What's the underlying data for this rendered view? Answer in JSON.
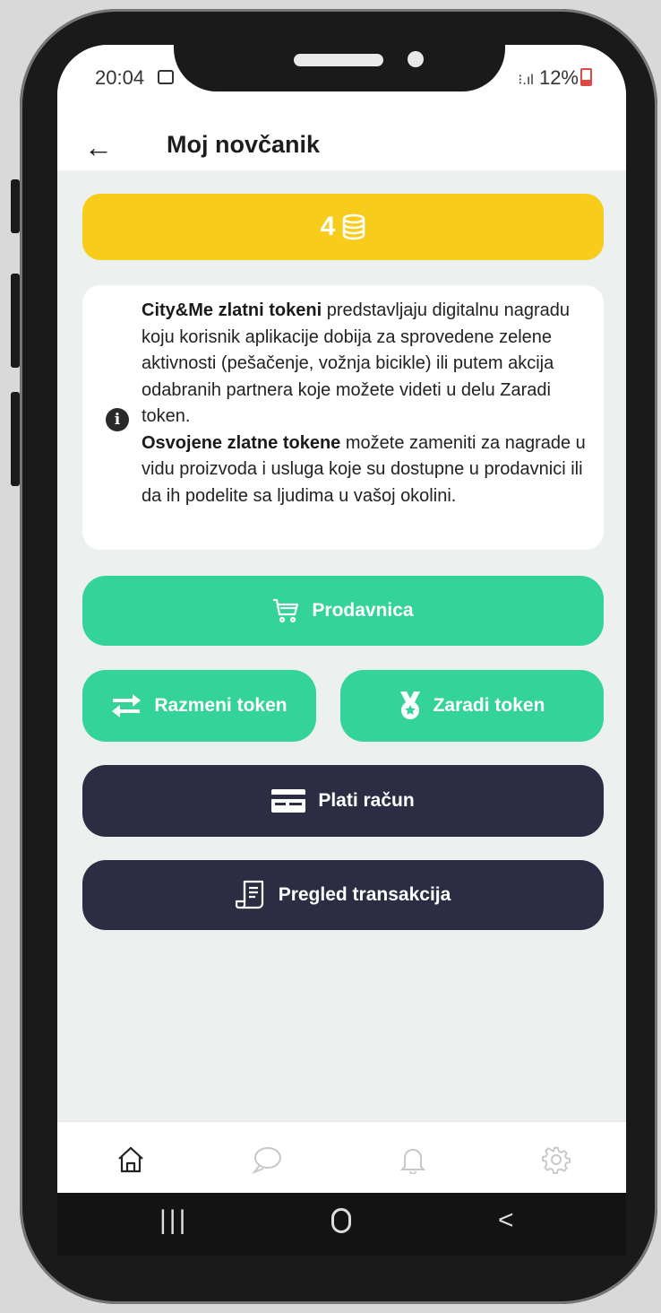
{
  "status": {
    "time": "20:04",
    "signal": "⁝.ıl",
    "battery": "12%"
  },
  "header": {
    "title": "Moj novčanik"
  },
  "balance": {
    "value": "4"
  },
  "info": {
    "line1_bold": "City&Me zlatni tokeni",
    "line1_rest": " predstavljaju digitalnu nagradu koju korisnik aplikacije dobija za sprovedene zelene aktivnosti (pešačenje, vožnja bicikle) ili putem akcija odabranih partnera koje možete videti u delu Zaradi token.",
    "line2_bold": "Osvojene zlatne tokene",
    "line2_rest": " možete zameniti za nagrade u vidu proizvoda i usluga koje su dostupne u prodavnici ili da ih podelite sa ljudima u vašoj okolini."
  },
  "buttons": {
    "shop": "Prodavnica",
    "exchange": "Razmeni token",
    "earn": "Zaradi token",
    "pay": "Plati račun",
    "history": "Pregled transakcija"
  },
  "colors": {
    "gold": "#f8cc1a",
    "green": "#33d39a",
    "dark": "#2c2d43"
  }
}
